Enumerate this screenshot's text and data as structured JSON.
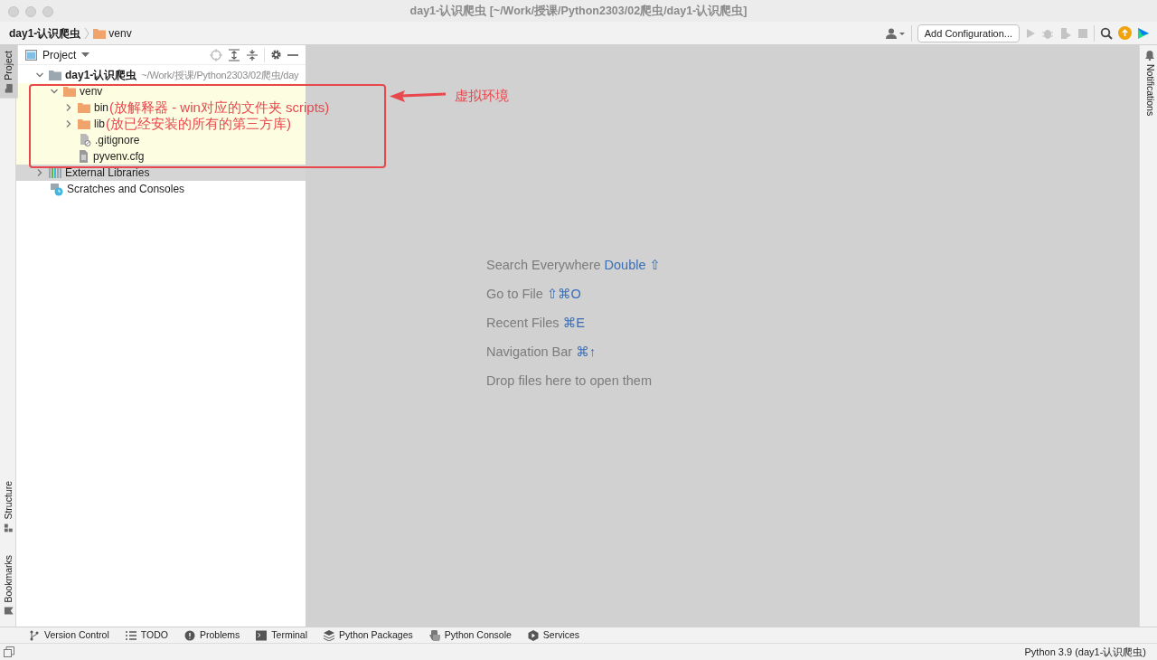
{
  "window": {
    "title": "day1-认识爬虫 [~/Work/授课/Python2303/02爬虫/day1-认识爬虫]"
  },
  "breadcrumb": [
    {
      "label": "day1-认识爬虫",
      "kind": "module"
    },
    {
      "label": "venv",
      "kind": "folder"
    }
  ],
  "toolbar": {
    "run_config": "Add Configuration..."
  },
  "left_tabs_top": [
    {
      "label": "Project",
      "selected": true
    }
  ],
  "left_tabs_bottom": [
    {
      "label": "Structure",
      "selected": false
    },
    {
      "label": "Bookmarks",
      "selected": false
    }
  ],
  "right_tabs": [
    {
      "label": "Notifications"
    }
  ],
  "project_panel": {
    "title": "Project",
    "tree": [
      {
        "label": "day1-认识爬虫",
        "kind": "module",
        "location": "~/Work/授课/Python2303/02爬虫/day",
        "expanded": true,
        "selected": false,
        "excluded": false,
        "children": [
          {
            "label": "venv",
            "kind": "folder",
            "expanded": true,
            "selected": false,
            "excluded": true,
            "children": [
              {
                "label": "bin",
                "kind": "folder",
                "expanded": false,
                "selected": false,
                "excluded": true,
                "note": "(放解释器 - win对应的文件夹 scripts)"
              },
              {
                "label": "lib",
                "kind": "folder",
                "expanded": false,
                "selected": false,
                "excluded": true,
                "note": "(放已经安装的所有的第三方库)"
              },
              {
                "label": ".gitignore",
                "kind": "ignore",
                "selected": false,
                "excluded": true
              },
              {
                "label": "pyvenv.cfg",
                "kind": "config",
                "selected": false,
                "excluded": true
              }
            ]
          }
        ]
      },
      {
        "label": "External Libraries",
        "kind": "libraries",
        "expanded": false,
        "selected": true,
        "excluded": false
      },
      {
        "label": "Scratches and Consoles",
        "kind": "scratches",
        "selected": false,
        "excluded": false
      }
    ]
  },
  "annotation": {
    "label": "虚拟环境"
  },
  "welcome": [
    {
      "label": "Search Everywhere",
      "shortcut": "Double ⇧"
    },
    {
      "label": "Go to File",
      "shortcut": "⇧⌘O"
    },
    {
      "label": "Recent Files",
      "shortcut": "⌘E"
    },
    {
      "label": "Navigation Bar",
      "shortcut": "⌘↑"
    },
    {
      "label": "Drop files here to open them"
    }
  ],
  "bottom_tabs": [
    {
      "label": "Version Control",
      "kind": "vcs"
    },
    {
      "label": "TODO",
      "kind": "todo"
    },
    {
      "label": "Problems",
      "kind": "problems"
    },
    {
      "label": "Terminal",
      "kind": "terminal"
    },
    {
      "label": "Python Packages",
      "kind": "packages"
    },
    {
      "label": "Python Console",
      "kind": "console"
    },
    {
      "label": "Services",
      "kind": "services"
    }
  ],
  "status_bar": {
    "interpreter": "Python 3.9 (day1-认识爬虫)"
  }
}
